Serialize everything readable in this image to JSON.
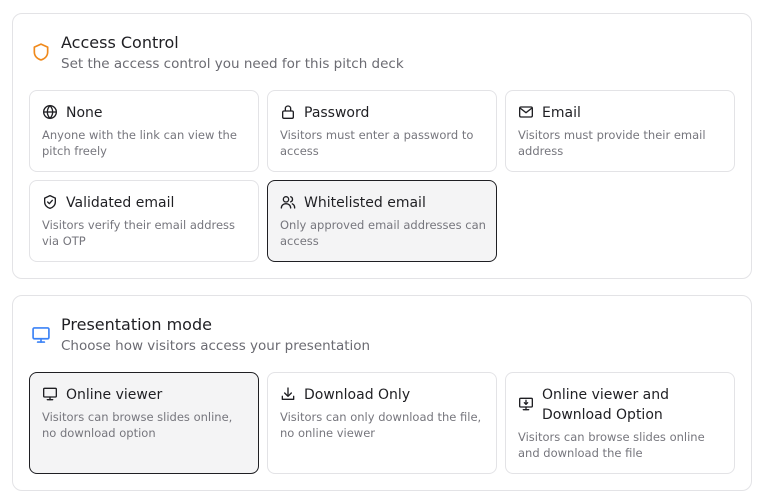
{
  "colors": {
    "accent_orange": "#f08a1c",
    "accent_blue": "#3b82f6",
    "selected_bg": "#f4f4f5",
    "border": "#e3e3e6"
  },
  "access_control": {
    "icon": "shield-icon",
    "title": "Access Control",
    "subtitle": "Set the access control you need for this pitch deck",
    "selected": "whitelisted-email",
    "options": [
      {
        "icon": "globe-icon",
        "title": "None",
        "description": "Anyone with the link can view the pitch freely"
      },
      {
        "icon": "lock-icon",
        "title": "Password",
        "description": "Visitors must enter a password to access"
      },
      {
        "icon": "mail-icon",
        "title": "Email",
        "description": "Visitors must provide their email address"
      },
      {
        "icon": "shield-check-icon",
        "title": "Validated email",
        "description": "Visitors verify their email address via OTP"
      },
      {
        "icon": "users-icon",
        "title": "Whitelisted email",
        "description": "Only approved email addresses can access"
      }
    ]
  },
  "presentation_mode": {
    "icon": "monitor-icon",
    "title": "Presentation mode",
    "subtitle": "Choose how visitors access your presentation",
    "selected": "online-viewer",
    "options": [
      {
        "icon": "monitor-icon",
        "title": "Online viewer",
        "description": "Visitors can browse slides online, no download option"
      },
      {
        "icon": "download-icon",
        "title": "Download Only",
        "description": "Visitors can only download the file, no online viewer"
      },
      {
        "icon": "monitor-download-icon",
        "title": "Online viewer and Download Option",
        "description": "Visitors can browse slides online and download the file"
      }
    ]
  }
}
